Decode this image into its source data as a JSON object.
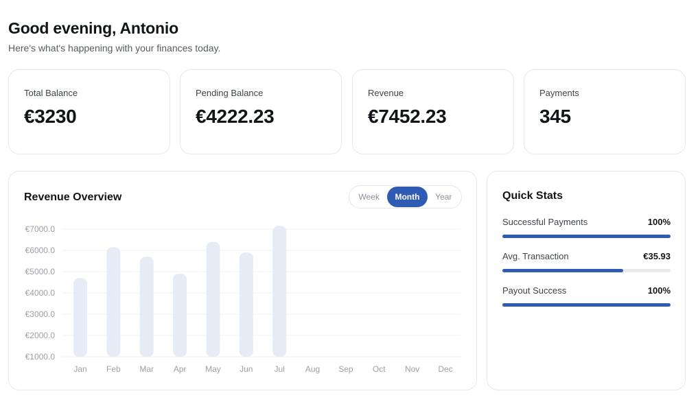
{
  "header": {
    "greeting": "Good evening, Antonio",
    "subtitle": "Here's what's happening with your finances today."
  },
  "stats": [
    {
      "label": "Total Balance",
      "value": "€3230"
    },
    {
      "label": "Pending Balance",
      "value": "€4222.23"
    },
    {
      "label": "Revenue",
      "value": "€7452.23"
    },
    {
      "label": "Payments",
      "value": "345"
    }
  ],
  "revenue_overview": {
    "title": "Revenue Overview",
    "periods": [
      "Week",
      "Month",
      "Year"
    ],
    "active_period": "Month"
  },
  "chart_data": {
    "type": "bar",
    "categories": [
      "Jan",
      "Feb",
      "Mar",
      "Apr",
      "May",
      "Jun",
      "Jul",
      "Aug",
      "Sep",
      "Oct",
      "Nov",
      "Dec"
    ],
    "values": [
      4700,
      6150,
      5700,
      4900,
      6400,
      5900,
      7150,
      null,
      null,
      null,
      null,
      null
    ],
    "y_ticks": [
      "€1000.0",
      "€2000.0",
      "€3000.0",
      "€4000.0",
      "€5000.0",
      "€6000.0",
      "€7000.0"
    ],
    "ylim": [
      1000,
      7000
    ],
    "bar_color": "#e6ecf6",
    "grid": true
  },
  "quick_stats": {
    "title": "Quick Stats",
    "items": [
      {
        "label": "Successful Payments",
        "value": "100%",
        "progress": 1.0
      },
      {
        "label": "Avg. Transaction",
        "value": "€35.93",
        "progress": 0.72
      },
      {
        "label": "Payout Success",
        "value": "100%",
        "progress": 1.0
      }
    ]
  },
  "colors": {
    "accent": "#2f5bb2",
    "card_border": "#e6e8ec",
    "bar": "#e6ecf6"
  }
}
